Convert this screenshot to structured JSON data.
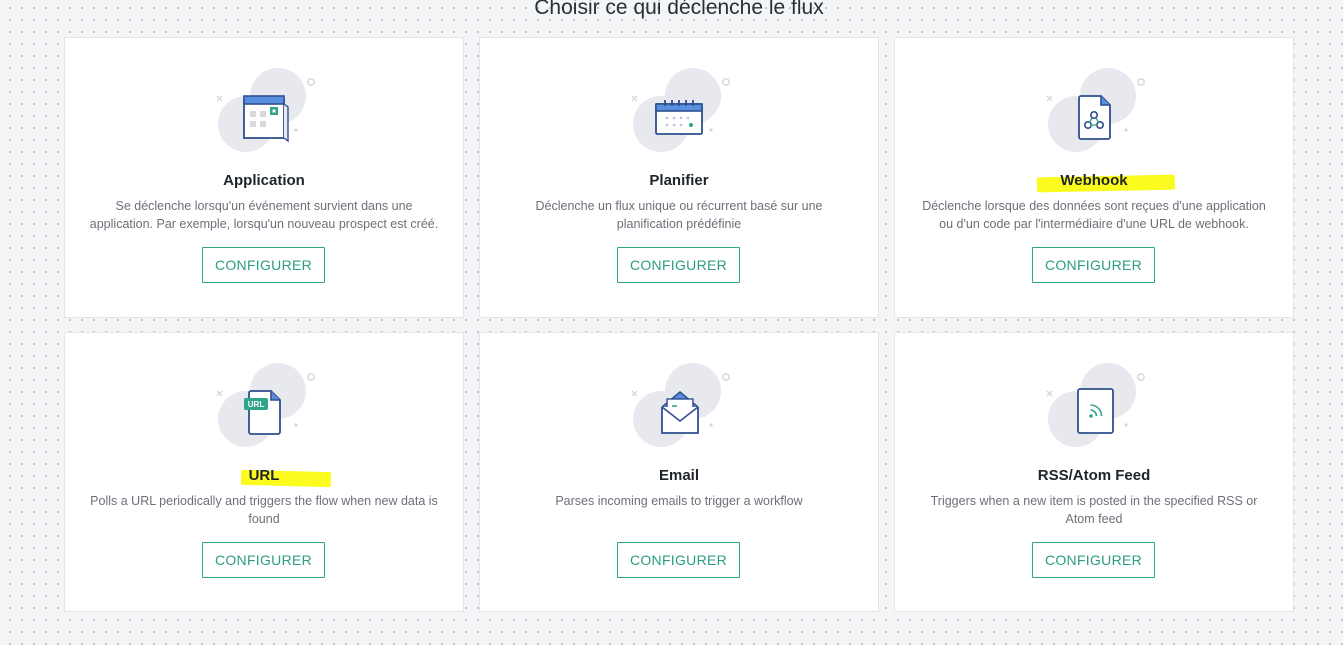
{
  "page": {
    "title": "Choisir ce qui déclenche le flux"
  },
  "colors": {
    "accent": "#2a9d82",
    "highlight": "#fbfb1e",
    "icon_stroke": "#2f4f8f",
    "icon_blob": "#e8e9ef"
  },
  "cards": [
    {
      "icon": "application-calendar-icon",
      "title": "Application",
      "description": "Se déclenche lorsqu'un événement survient dans une application. Par exemple, lorsqu'un nouveau prospect est créé.",
      "button_label": "CONFIGURER"
    },
    {
      "icon": "schedule-calendar-icon",
      "title": "Planifier",
      "description": "Déclenche un flux unique ou récurrent basé sur une planification prédéfinie",
      "button_label": "CONFIGURER"
    },
    {
      "icon": "webhook-file-icon",
      "title": "Webhook",
      "description": "Déclenche lorsque des données sont reçues d'une application ou d'un code par l'intermédiaire d'une URL de webhook.",
      "button_label": "CONFIGURER"
    },
    {
      "icon": "url-file-icon",
      "icon_label": "URL",
      "title": "URL",
      "description": "Polls a URL periodically and triggers the flow when new data is found",
      "button_label": "CONFIGURER"
    },
    {
      "icon": "email-envelope-icon",
      "title": "Email",
      "description": "Parses incoming emails to trigger a workflow",
      "button_label": "CONFIGURER"
    },
    {
      "icon": "rss-feed-icon",
      "title": "RSS/Atom Feed",
      "description": "Triggers when a new item is posted in the specified RSS or Atom feed",
      "button_label": "CONFIGURER"
    }
  ]
}
